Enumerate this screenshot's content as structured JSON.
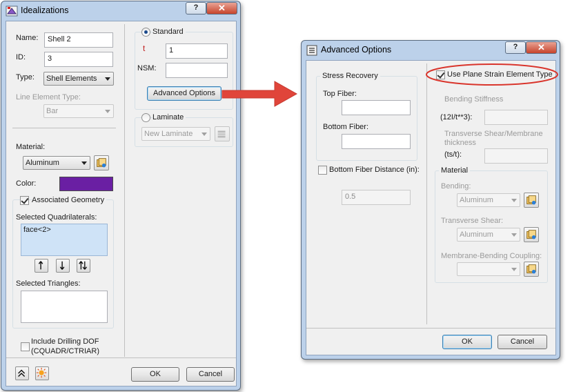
{
  "idealizations": {
    "title": "Idealizations",
    "help": "?",
    "close": "✕",
    "name_label": "Name:",
    "name_value": "Shell 2",
    "id_label": "ID:",
    "id_value": "3",
    "type_label": "Type:",
    "type_value": "Shell Elements",
    "line_type_label": "Line Element Type:",
    "line_type_value": "Bar",
    "material_label": "Material:",
    "material_value": "Aluminum",
    "color_label": "Color:",
    "color_value": "#6a1fa3",
    "assoc_geom_label": "Associated Geometry",
    "sel_quad_label": "Selected Quadrilaterals:",
    "sel_quad_items": [
      "face<2>"
    ],
    "sel_tri_label": "Selected Triangles:",
    "drilling_label_1": "Include Drilling DOF",
    "drilling_label_2": "(CQUADR/CTRIAR)",
    "standard_label": "Standard",
    "t_label": "t",
    "t_value": "1",
    "nsm_label": "NSM:",
    "nsm_value": "",
    "advanced_button": "Advanced Options",
    "laminate_label": "Laminate",
    "laminate_value": "New Laminate",
    "ok": "OK",
    "cancel": "Cancel"
  },
  "advanced": {
    "title": "Advanced Options",
    "help": "?",
    "close": "✕",
    "stress_recovery_label": "Stress Recovery",
    "top_fiber_label": "Top Fiber:",
    "top_fiber_value": "",
    "bottom_fiber_label": "Bottom Fiber:",
    "bottom_fiber_value": "",
    "bottom_fiber_distance_label": "Bottom Fiber Distance (in):",
    "bottom_fiber_distance_value": "0.5",
    "plane_strain_label": "Use Plane Strain Element Type",
    "bending_stiffness_label": "Bending Stiffness",
    "bending_stiffness_expr": "(12I/t**3):",
    "ts_label_1": "Transverse Shear/Membrane",
    "ts_label_2": "thickness",
    "ts_label_3": "(ts/t):",
    "material_group_label": "Material",
    "bending_label": "Bending:",
    "bending_value": "Aluminum",
    "trans_shear_label": "Transverse Shear:",
    "trans_shear_value": "Aluminum",
    "membrane_label": "Membrane-Bending Coupling:",
    "membrane_value": "",
    "ok": "OK",
    "cancel": "Cancel"
  },
  "colors": {
    "highlight_ellipse": "#d9342b",
    "arrow": "#e0453a",
    "selection_list_bg": "#cfe3f7"
  }
}
